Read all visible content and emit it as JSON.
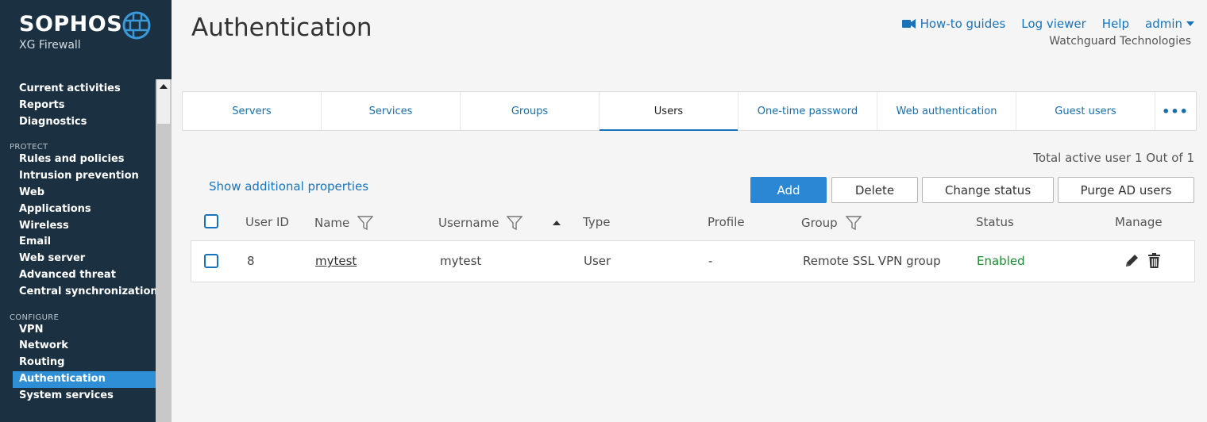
{
  "brand": {
    "name": "SOPHOS",
    "product": "XG Firewall"
  },
  "nav": {
    "top_items": [
      "Current activities",
      "Reports",
      "Diagnostics"
    ],
    "protect_label": "PROTECT",
    "protect_items": [
      "Rules and policies",
      "Intrusion prevention",
      "Web",
      "Applications",
      "Wireless",
      "Email",
      "Web server",
      "Advanced threat",
      "Central synchronization"
    ],
    "configure_label": "CONFIGURE",
    "configure_items": [
      "VPN",
      "Network",
      "Routing",
      "Authentication",
      "System services"
    ],
    "active": "Authentication"
  },
  "header": {
    "title": "Authentication",
    "links": {
      "howto": "How-to guides",
      "log_viewer": "Log viewer",
      "help": "Help",
      "user": "admin"
    },
    "company": "Watchguard Technologies",
    "icons": {
      "howto": "video-camera-icon",
      "user_menu": "caret-down-icon"
    }
  },
  "tabs": [
    "Servers",
    "Services",
    "Groups",
    "Users",
    "One-time password",
    "Web authentication",
    "Guest users"
  ],
  "active_tab": "Users",
  "more_tabs": "•••",
  "summary": "Total active user 1 Out of 1",
  "show_additional": "Show additional properties",
  "toolbar": {
    "add": "Add",
    "delete": "Delete",
    "change_status": "Change status",
    "purge": "Purge AD users"
  },
  "table": {
    "headers": {
      "user_id": "User ID",
      "name": "Name",
      "username": "Username",
      "type": "Type",
      "profile": "Profile",
      "group": "Group",
      "status": "Status",
      "manage": "Manage"
    },
    "rows": [
      {
        "user_id": "8",
        "name": "mytest",
        "username": "mytest",
        "type": "User",
        "profile": "-",
        "group": "Remote SSL VPN group",
        "status": "Enabled"
      }
    ]
  },
  "colors": {
    "sidebar_bg": "#1b3142",
    "accent": "#2b87d3",
    "link": "#1a73b8",
    "enabled": "#1d8a2f"
  }
}
